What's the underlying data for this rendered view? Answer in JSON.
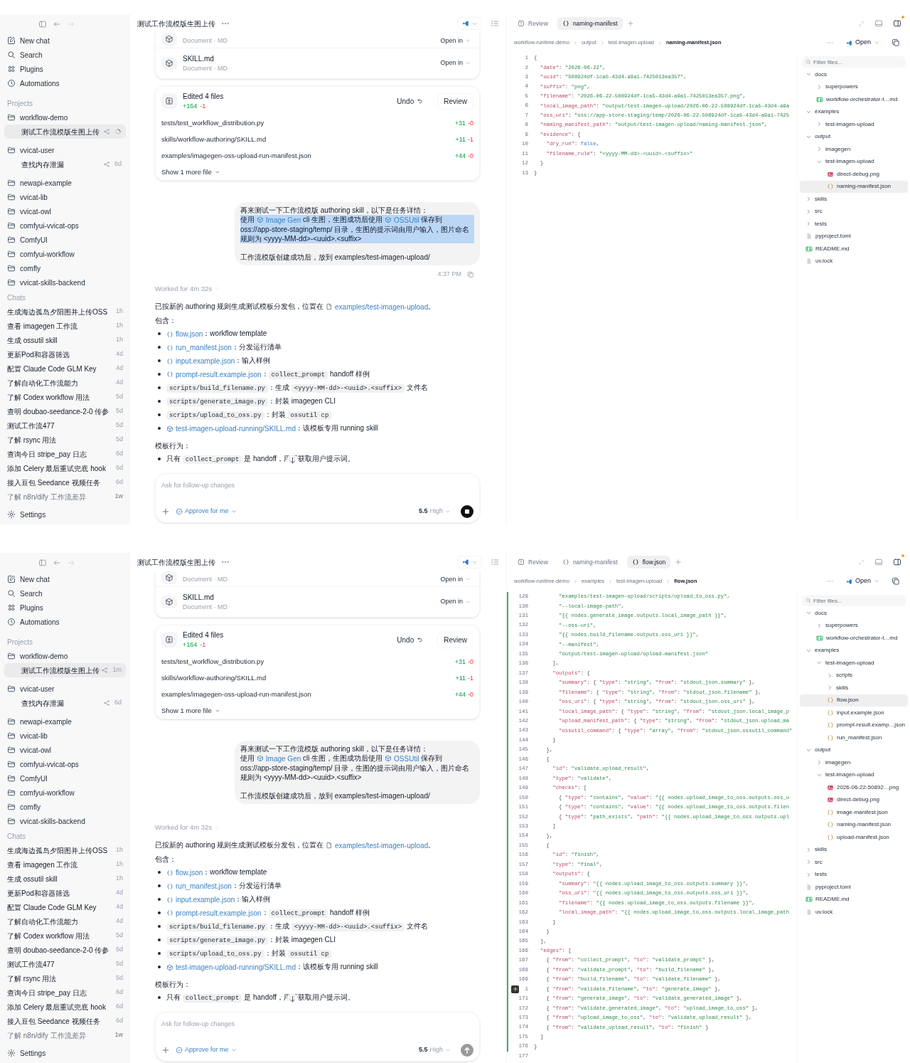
{
  "screens": [
    {
      "sidebar": {
        "nav": [
          {
            "label": "New chat"
          },
          {
            "label": "Search"
          },
          {
            "label": "Plugins"
          },
          {
            "label": "Automations"
          }
        ],
        "projects_heading": "Projects",
        "projects": [
          {
            "label": "workflow-demo",
            "children": [
              {
                "label": "测试工作流模版生图上传",
                "selected": true,
                "running": true
              }
            ]
          },
          {
            "label": "vvicat-user",
            "children": [
              {
                "label": "查找内存泄漏",
                "selected": false,
                "running": false,
                "age": "6d"
              }
            ]
          },
          {
            "label": "newapi-example"
          },
          {
            "label": "vvicat-lib"
          },
          {
            "label": "vvicat-owl"
          },
          {
            "label": "comfyui-vvicat-ops"
          },
          {
            "label": "ComfyUI"
          },
          {
            "label": "comfyui-workflow"
          },
          {
            "label": "comfly"
          },
          {
            "label": "vvicat-skills-backend"
          }
        ],
        "chats_heading": "Chats",
        "chats": [
          {
            "title": "生成海边孤岛夕阳图并上传OSS",
            "age": "1h"
          },
          {
            "title": "查看 imagegen 工作流",
            "age": "1h"
          },
          {
            "title": "生成 ossutil skill",
            "age": "1h"
          },
          {
            "title": "更新Pod和容器筛选",
            "age": "4d"
          },
          {
            "title": "配置 Claude Code GLM Key",
            "age": "4d"
          },
          {
            "title": "了解自动化工作流能力",
            "age": "4d"
          },
          {
            "title": "了解 Codex workflow 用法",
            "age": "5d"
          },
          {
            "title": "查明 doubao-seedance-2-0 传参",
            "age": "5d"
          },
          {
            "title": "测试工作流477",
            "age": "5d"
          },
          {
            "title": "了解 rsync 用法",
            "age": "5d"
          },
          {
            "title": "查询今日 stripe_pay 日志",
            "age": "6d"
          },
          {
            "title": "添加 Celery 最后重试兜底 hook",
            "age": "6d"
          },
          {
            "title": "接入豆包 Seedance 视频任务",
            "age": "6d"
          },
          {
            "title": "了解 n8n/dify 工作流差异",
            "age": "1w"
          }
        ],
        "settings": "Settings"
      },
      "chat": {
        "title": "测试工作流模版生图上传",
        "attachments": [
          {
            "subtitle": "Document · MD",
            "action": "Open in"
          },
          {
            "name": "SKILL.md",
            "subtitle": "Document · MD",
            "action": "Open in"
          }
        ],
        "edits": {
          "title": "Edited 4 files",
          "added": "+164",
          "removed": "-1",
          "undo": "Undo",
          "review": "Review",
          "files": [
            {
              "path": "tests/test_workflow_distribution.py",
              "added": "+31",
              "removed": "-0"
            },
            {
              "path": "skills/workflow-authoring/SKILL.md",
              "added": "+11",
              "removed": "-1"
            },
            {
              "path": "examples/imagegen-oss-upload-run-manifest.json",
              "added": "+44",
              "removed": "-0"
            }
          ],
          "more": "Show 1 more file"
        },
        "message": {
          "blocks": [
            [
              {
                "selected": false,
                "segments": [
                  {
                    "t": "再来测试一下工作流模版 authoring skill，以下是任务详情："
                  }
                ]
              },
              {
                "selected": true,
                "segments": [
                  {
                    "t": "使用 "
                  },
                  {
                    "t": "Image Gen",
                    "kind": "skill"
                  },
                  {
                    "t": " cli 生图，生图成功后使用 "
                  },
                  {
                    "t": "OSSUtil",
                    "kind": "skill"
                  },
                  {
                    "t": " 保存到 oss://app-store-staging/temp/ 目录，生图的提示词由用户输入，图片命名规则为 <yyyy-MM-dd>-<uuid>.<suffix>"
                  }
                ]
              }
            ],
            [
              {
                "selected": false,
                "segments": [
                  {
                    "t": "工作流模版创建成功后，放到 examples/test-imagen-upload/"
                  }
                ]
              }
            ]
          ],
          "time": "4:37 PM"
        },
        "worked": "Worked for 4m 32s",
        "reply": {
          "intro": [
            {
              "t": "已按新的 authoring 规则生成测试模板分发包，位置在 "
            },
            {
              "t": "examples/test-imagen-upload",
              "kind": "folder"
            },
            {
              "t": "。"
            }
          ],
          "contents_heading": "包含：",
          "items": [
            [
              {
                "t": "flow.json",
                "kind": "file"
              },
              {
                "t": "：workflow template"
              }
            ],
            [
              {
                "t": "run_manifest.json",
                "kind": "file"
              },
              {
                "t": "：分发运行清单"
              }
            ],
            [
              {
                "t": "input.example.json",
                "kind": "file"
              },
              {
                "t": "：输入样例"
              }
            ],
            [
              {
                "t": "prompt-result.example.json",
                "kind": "file"
              },
              {
                "t": "："
              },
              {
                "t": "collect_prompt",
                "kind": "code"
              },
              {
                "t": " handoff 样例"
              }
            ],
            [
              {
                "t": "scripts/build_filename.py",
                "kind": "code"
              },
              {
                "t": "：生成 "
              },
              {
                "t": "<yyyy-MM-dd>-<uuid>.<suffix>",
                "kind": "code"
              },
              {
                "t": " 文件名"
              }
            ],
            [
              {
                "t": "scripts/generate_image.py",
                "kind": "code"
              },
              {
                "t": "：封装 imagegen CLI"
              }
            ],
            [
              {
                "t": "scripts/upload_to_oss.py",
                "kind": "code"
              },
              {
                "t": "：封装 "
              },
              {
                "t": "ossutil cp",
                "kind": "code"
              }
            ],
            [
              {
                "t": "test-imagen-upload-running/SKILL.md",
                "kind": "skill"
              },
              {
                "t": "：该模板专用 running skill"
              }
            ]
          ],
          "behavior_heading": "模板行为：",
          "behavior_items": [
            [
              {
                "t": "只有 "
              },
              {
                "t": "collect_prompt",
                "kind": "code"
              },
              {
                "t": " 是 handoff，用于获取用户提示词。"
              }
            ]
          ]
        },
        "composer": {
          "placeholder": "Ask for follow-up changes",
          "approval": "Approve for me",
          "model": "5.5",
          "effort": "High",
          "running": true
        }
      },
      "editor": {
        "tabs": [
          {
            "label": "Review",
            "kind": "review",
            "selected": false
          },
          {
            "label": "naming-manifest",
            "kind": "json",
            "selected": true
          }
        ],
        "breadcrumb": [
          "workflow-runtime-demo",
          "output",
          "test-imagen-upload",
          "naming-manifest.json"
        ],
        "open": "Open",
        "lines": [
          {
            "n": "1",
            "text": "{"
          },
          {
            "n": "2",
            "text": "  \"date\": \"2026-06-22\","
          },
          {
            "n": "3",
            "text": "  \"uuid\": \"508924df-1ca5-43d4-a9a1-7425013ea357\","
          },
          {
            "n": "4",
            "text": "  \"suffix\": \"png\","
          },
          {
            "n": "5",
            "text": "  \"filename\": \"2026-06-22-508924df-1ca5-43d4-a9a1-7425013ea357.png\","
          },
          {
            "n": "6",
            "text": "  \"local_image_path\": \"output/test-imagen-upload/2026-06-22-508924df-1ca5-43d4-a9a"
          },
          {
            "n": "7",
            "text": "  \"oss_uri\": \"oss://app-store-staging/temp/2026-06-22-508924df-1ca5-43d4-a9a1-7425"
          },
          {
            "n": "8",
            "text": "  \"naming_manifest_path\": \"output/test-imagen-upload/naming-manifest.json\","
          },
          {
            "n": "9",
            "text": "  \"evidence\": {"
          },
          {
            "n": "10",
            "text": "    \"dry_run\": false,"
          },
          {
            "n": "11",
            "text": "    \"filename_rule\": \"<yyyy-MM-dd>-<uuid>.<suffix>\""
          },
          {
            "n": "12",
            "text": "  }"
          },
          {
            "n": "13",
            "text": "}"
          }
        ],
        "filter_placeholder": "Filter files...",
        "tree": [
          {
            "label": "docs",
            "kind": "folder",
            "expanded": true,
            "selected": false,
            "children": [
              {
                "label": "superpowers",
                "kind": "folder",
                "expanded": false,
                "selected": false
              },
              {
                "label": "workflow-orchestrator-t…md",
                "kind": "md",
                "selected": false
              }
            ]
          },
          {
            "label": "examples",
            "kind": "folder",
            "expanded": true,
            "selected": false,
            "children": [
              {
                "label": "test-imagen-upload",
                "kind": "folder",
                "expanded": false,
                "selected": false
              }
            ]
          },
          {
            "label": "output",
            "kind": "folder",
            "expanded": true,
            "selected": false,
            "children": [
              {
                "label": "imagegen",
                "kind": "folder",
                "expanded": false,
                "selected": false
              },
              {
                "label": "test-imagen-upload",
                "kind": "folder",
                "expanded": true,
                "selected": false,
                "children": [
                  {
                    "label": "direct-debug.png",
                    "kind": "image",
                    "selected": false
                  },
                  {
                    "label": "naming-manifest.json",
                    "kind": "json",
                    "selected": true
                  }
                ]
              }
            ]
          },
          {
            "label": "skills",
            "kind": "folder",
            "expanded": false,
            "selected": false
          },
          {
            "label": "src",
            "kind": "folder",
            "expanded": false,
            "selected": false
          },
          {
            "label": "tests",
            "kind": "folder",
            "expanded": false,
            "selected": false
          },
          {
            "label": "pyproject.toml",
            "kind": "file",
            "selected": false
          },
          {
            "label": "README.md",
            "kind": "md",
            "selected": false
          },
          {
            "label": "uv.lock",
            "kind": "file",
            "selected": false
          }
        ]
      }
    },
    {
      "sidebar": {
        "nav": [
          {
            "label": "New chat"
          },
          {
            "label": "Search"
          },
          {
            "label": "Plugins"
          },
          {
            "label": "Automations"
          }
        ],
        "projects_heading": "Projects",
        "projects": [
          {
            "label": "workflow-demo",
            "children": [
              {
                "label": "测试工作流模版生图上传",
                "selected": true,
                "running": false,
                "age": "1m"
              }
            ]
          },
          {
            "label": "vvicat-user",
            "children": [
              {
                "label": "查找内存泄漏",
                "selected": false,
                "running": false,
                "age": "6d"
              }
            ]
          },
          {
            "label": "newapi-example"
          },
          {
            "label": "vvicat-lib"
          },
          {
            "label": "vvicat-owl"
          },
          {
            "label": "comfyui-vvicat-ops"
          },
          {
            "label": "ComfyUI"
          },
          {
            "label": "comfyui-workflow"
          },
          {
            "label": "comfly"
          },
          {
            "label": "vvicat-skills-backend"
          }
        ],
        "chats_heading": "Chats",
        "chats": [
          {
            "title": "生成海边孤岛夕阳图并上传OSS",
            "age": "1h"
          },
          {
            "title": "查看 imagegen 工作流",
            "age": "1h"
          },
          {
            "title": "生成 ossutil skill",
            "age": "1h"
          },
          {
            "title": "更新Pod和容器筛选",
            "age": "4d"
          },
          {
            "title": "配置 Claude Code GLM Key",
            "age": "4d"
          },
          {
            "title": "了解自动化工作流能力",
            "age": "4d"
          },
          {
            "title": "了解 Codex workflow 用法",
            "age": "5d"
          },
          {
            "title": "查明 doubao-seedance-2-0 传参",
            "age": "5d"
          },
          {
            "title": "测试工作流477",
            "age": "5d"
          },
          {
            "title": "了解 rsync 用法",
            "age": "5d"
          },
          {
            "title": "查询今日 stripe_pay 日志",
            "age": "6d"
          },
          {
            "title": "添加 Celery 最后重试兜底 hook",
            "age": "6d"
          },
          {
            "title": "接入豆包 Seedance 视频任务",
            "age": "6d"
          },
          {
            "title": "了解 n8n/dify 工作流差异",
            "age": "1w"
          }
        ],
        "settings": "Settings"
      },
      "chat": {
        "title": "测试工作流模版生图上传",
        "attachments": [
          {
            "subtitle": "Document · MD",
            "action": "Open in"
          },
          {
            "name": "SKILL.md",
            "subtitle": "Document · MD",
            "action": "Open in"
          }
        ],
        "edits": {
          "title": "Edited 4 files",
          "added": "+164",
          "removed": "-1",
          "undo": "Undo",
          "review": "Review",
          "files": [
            {
              "path": "tests/test_workflow_distribution.py",
              "added": "+31",
              "removed": "-0"
            },
            {
              "path": "skills/workflow-authoring/SKILL.md",
              "added": "+11",
              "removed": "-1"
            },
            {
              "path": "examples/imagegen-oss-upload-run-manifest.json",
              "added": "+44",
              "removed": "-0"
            }
          ],
          "more": "Show 1 more file"
        },
        "message": {
          "blocks": [
            [
              {
                "selected": false,
                "segments": [
                  {
                    "t": "再来测试一下工作流模版 authoring skill，以下是任务详情："
                  }
                ]
              },
              {
                "selected": false,
                "segments": [
                  {
                    "t": "使用 "
                  },
                  {
                    "t": "Image Gen",
                    "kind": "skill"
                  },
                  {
                    "t": " cli 生图，生图成功后使用 "
                  },
                  {
                    "t": "OSSUtil",
                    "kind": "skill"
                  },
                  {
                    "t": " 保存到 oss://app-store-staging/temp/ 目录，生图的提示词由用户输入，图片命名规则为 <yyyy-MM-dd>-<uuid>.<suffix>"
                  }
                ]
              }
            ],
            [
              {
                "selected": false,
                "segments": [
                  {
                    "t": "工作流模版创建成功后，放到 examples/test-imagen-upload/"
                  }
                ]
              }
            ]
          ]
        },
        "worked": "Worked for 4m 32s",
        "reply": {
          "intro": [
            {
              "t": "已按新的 authoring 规则生成测试模板分发包，位置在 "
            },
            {
              "t": "examples/test-imagen-upload",
              "kind": "folder"
            },
            {
              "t": "。"
            }
          ],
          "contents_heading": "包含：",
          "items": [
            [
              {
                "t": "flow.json",
                "kind": "file"
              },
              {
                "t": "：workflow template"
              }
            ],
            [
              {
                "t": "run_manifest.json",
                "kind": "file"
              },
              {
                "t": "：分发运行清单"
              }
            ],
            [
              {
                "t": "input.example.json",
                "kind": "file"
              },
              {
                "t": "：输入样例"
              }
            ],
            [
              {
                "t": "prompt-result.example.json",
                "kind": "file"
              },
              {
                "t": "："
              },
              {
                "t": "collect_prompt",
                "kind": "code"
              },
              {
                "t": " handoff 样例"
              }
            ],
            [
              {
                "t": "scripts/build_filename.py",
                "kind": "code"
              },
              {
                "t": "：生成 "
              },
              {
                "t": "<yyyy-MM-dd>-<uuid>.<suffix>",
                "kind": "code"
              },
              {
                "t": " 文件名"
              }
            ],
            [
              {
                "t": "scripts/generate_image.py",
                "kind": "code"
              },
              {
                "t": "：封装 imagegen CLI"
              }
            ],
            [
              {
                "t": "scripts/upload_to_oss.py",
                "kind": "code"
              },
              {
                "t": "：封装 "
              },
              {
                "t": "ossutil cp",
                "kind": "code"
              }
            ],
            [
              {
                "t": "test-imagen-upload-running/SKILL.md",
                "kind": "skill"
              },
              {
                "t": "：该模板专用 running skill"
              }
            ]
          ],
          "behavior_heading": "模板行为：",
          "behavior_items": [
            [
              {
                "t": "只有 "
              },
              {
                "t": "collect_prompt",
                "kind": "code"
              },
              {
                "t": " 是 handoff，用于获取用户提示词。"
              }
            ]
          ]
        },
        "composer": {
          "placeholder": "Ask for follow-up changes",
          "approval": "Approve for me",
          "model": "5.5",
          "effort": "High",
          "running": false
        }
      },
      "editor": {
        "tabs": [
          {
            "label": "Review",
            "kind": "review",
            "selected": false
          },
          {
            "label": "naming-manifest",
            "kind": "json",
            "selected": false
          },
          {
            "label": "flow.json",
            "kind": "json",
            "selected": true
          }
        ],
        "breadcrumb": [
          "workflow-runtime-demo",
          "examples",
          "test-imagen-upload",
          "flow.json"
        ],
        "open": "Open",
        "lines": [
          {
            "n": "129",
            "added": true,
            "text": "        \"examples/test-imagen-upload/scripts/upload_to_oss.py\","
          },
          {
            "n": "130",
            "added": true,
            "text": "        \"--local-image-path\","
          },
          {
            "n": "131",
            "added": true,
            "text": "        \"{{ nodes.generate_image.outputs.local_image_path }}\","
          },
          {
            "n": "132",
            "added": true,
            "text": "        \"--oss-uri\","
          },
          {
            "n": "133",
            "added": true,
            "text": "        \"{{ nodes.build_filename.outputs.oss_uri }}\","
          },
          {
            "n": "134",
            "added": true,
            "text": "        \"--manifest\","
          },
          {
            "n": "135",
            "added": true,
            "text": "        \"output/test-imagen-upload/upload-manifest.json\""
          },
          {
            "n": "136",
            "added": true,
            "text": "      ],"
          },
          {
            "n": "137",
            "added": true,
            "text": "      \"outputs\": {"
          },
          {
            "n": "138",
            "added": true,
            "text": "        \"summary\": { \"type\": \"string\", \"from\": \"stdout_json.summary\" },"
          },
          {
            "n": "139",
            "added": true,
            "text": "        \"filename\": { \"type\": \"string\", \"from\": \"stdout_json.filename\" },"
          },
          {
            "n": "140",
            "added": true,
            "text": "        \"oss_uri\": { \"type\": \"string\", \"from\": \"stdout_json.oss_uri\" },"
          },
          {
            "n": "141",
            "added": true,
            "text": "        \"local_image_path\": { \"type\": \"string\", \"from\": \"stdout_json.local_image_p"
          },
          {
            "n": "142",
            "added": true,
            "text": "        \"upload_manifest_path\": { \"type\": \"string\", \"from\": \"stdout_json.upload_ma"
          },
          {
            "n": "143",
            "added": true,
            "text": "        \"ossutil_command\": { \"type\": \"array\", \"from\": \"stdout_json.ossutil_command\""
          },
          {
            "n": "144",
            "added": true,
            "text": "      }"
          },
          {
            "n": "145",
            "added": true,
            "text": "    },"
          },
          {
            "n": "146",
            "added": true,
            "text": "    {"
          },
          {
            "n": "147",
            "added": true,
            "text": "      \"id\": \"validate_upload_result\","
          },
          {
            "n": "148",
            "added": true,
            "text": "      \"type\": \"validate\","
          },
          {
            "n": "149",
            "added": true,
            "text": "      \"checks\": ["
          },
          {
            "n": "150",
            "added": true,
            "text": "        { \"type\": \"contains\", \"value\": \"{{ nodes.upload_image_to_oss.outputs.oss_u"
          },
          {
            "n": "151",
            "added": true,
            "text": "        { \"type\": \"contains\", \"value\": \"{{ nodes.upload_image_to_oss.outputs.filen"
          },
          {
            "n": "152",
            "added": true,
            "text": "        { \"type\": \"path_exists\", \"path\": \"{{ nodes.upload_image_to_oss.outputs.upl"
          },
          {
            "n": "153",
            "added": true,
            "text": "      ]"
          },
          {
            "n": "154",
            "added": true,
            "text": "    },"
          },
          {
            "n": "155",
            "added": true,
            "text": "    {"
          },
          {
            "n": "156",
            "added": true,
            "text": "      \"id\": \"finish\","
          },
          {
            "n": "157",
            "added": true,
            "text": "      \"type\": \"final\","
          },
          {
            "n": "158",
            "added": true,
            "text": "      \"outputs\": {"
          },
          {
            "n": "159",
            "added": true,
            "text": "        \"summary\": \"{{ nodes.upload_image_to_oss.outputs.summary }}\","
          },
          {
            "n": "160",
            "added": true,
            "text": "        \"oss_uri\": \"{{ nodes.upload_image_to_oss.outputs.oss_uri }}\","
          },
          {
            "n": "161",
            "added": true,
            "text": "        \"filename\": \"{{ nodes.upload_image_to_oss.outputs.filename }}\","
          },
          {
            "n": "162",
            "added": true,
            "text": "        \"local_image_path\": \"{{ nodes.upload_image_to_oss.outputs.local_image_path"
          },
          {
            "n": "163",
            "added": true,
            "text": "      }"
          },
          {
            "n": "164",
            "added": true,
            "text": "    }"
          },
          {
            "n": "165",
            "added": true,
            "text": "  ],"
          },
          {
            "n": "166",
            "added": true,
            "text": "  \"edges\": ["
          },
          {
            "n": "167",
            "added": true,
            "text": "    { \"from\": \"collect_prompt\", \"to\": \"validate_prompt\" },"
          },
          {
            "n": "168",
            "added": true,
            "text": "    { \"from\": \"validate_prompt\", \"to\": \"build_filename\" },"
          },
          {
            "n": "169",
            "added": true,
            "text": "    { \"from\": \"build_filename\", \"to\": \"validate_filename\" },"
          },
          {
            "n": "1",
            "added": true,
            "add_button": true,
            "text": "    { \"from\": \"validate_filename\", \"to\": \"generate_image\" },"
          },
          {
            "n": "171",
            "added": true,
            "text": "    { \"from\": \"generate_image\", \"to\": \"validate_generated_image\" },"
          },
          {
            "n": "172",
            "added": true,
            "text": "    { \"from\": \"validate_generated_image\", \"to\": \"upload_image_to_oss\" },"
          },
          {
            "n": "173",
            "added": true,
            "text": "    { \"from\": \"upload_image_to_oss\", \"to\": \"validate_upload_result\" },"
          },
          {
            "n": "174",
            "added": true,
            "text": "    { \"from\": \"validate_upload_result\", \"to\": \"finish\" }"
          },
          {
            "n": "175",
            "added": true,
            "text": "  ]"
          },
          {
            "n": "176",
            "added": true,
            "text": "}"
          },
          {
            "n": "177"
          }
        ],
        "filter_placeholder": "Filter files...",
        "tree": [
          {
            "label": "docs",
            "kind": "folder",
            "expanded": true,
            "selected": false,
            "children": [
              {
                "label": "superpowers",
                "kind": "folder",
                "expanded": false,
                "selected": false
              },
              {
                "label": "workflow-orchestrator-t…md",
                "kind": "md",
                "selected": false
              }
            ]
          },
          {
            "label": "examples",
            "kind": "folder",
            "expanded": true,
            "selected": false,
            "children": [
              {
                "label": "test-imagen-upload",
                "kind": "folder",
                "expanded": true,
                "selected": false,
                "children": [
                  {
                    "label": "scripts",
                    "kind": "folder",
                    "expanded": false,
                    "selected": false
                  },
                  {
                    "label": "skills",
                    "kind": "folder",
                    "expanded": false,
                    "selected": false
                  },
                  {
                    "label": "flow.json",
                    "kind": "json",
                    "selected": true
                  },
                  {
                    "label": "input.example.json",
                    "kind": "json",
                    "selected": false
                  },
                  {
                    "label": "prompt-result.examp…json",
                    "kind": "json",
                    "selected": false
                  },
                  {
                    "label": "run_manifest.json",
                    "kind": "json",
                    "selected": false
                  }
                ]
              }
            ]
          },
          {
            "label": "output",
            "kind": "folder",
            "expanded": true,
            "selected": false,
            "children": [
              {
                "label": "imagegen",
                "kind": "folder",
                "expanded": false,
                "selected": false
              },
              {
                "label": "test-imagen-upload",
                "kind": "folder",
                "expanded": true,
                "selected": false,
                "children": [
                  {
                    "label": "2026-06-22-50892…png",
                    "kind": "image",
                    "selected": false
                  },
                  {
                    "label": "direct-debug.png",
                    "kind": "image",
                    "selected": false
                  },
                  {
                    "label": "image-manifest.json",
                    "kind": "json",
                    "selected": false
                  },
                  {
                    "label": "naming-manifest.json",
                    "kind": "json",
                    "selected": false
                  },
                  {
                    "label": "upload-manifest.json",
                    "kind": "json",
                    "selected": false
                  }
                ]
              }
            ]
          },
          {
            "label": "skills",
            "kind": "folder",
            "expanded": false,
            "selected": false
          },
          {
            "label": "src",
            "kind": "folder",
            "expanded": false,
            "selected": false
          },
          {
            "label": "tests",
            "kind": "folder",
            "expanded": false,
            "selected": false
          },
          {
            "label": "pyproject.toml",
            "kind": "file",
            "selected": false
          },
          {
            "label": "README.md",
            "kind": "md",
            "selected": false
          },
          {
            "label": "uv.lock",
            "kind": "file",
            "selected": false
          }
        ]
      }
    }
  ]
}
